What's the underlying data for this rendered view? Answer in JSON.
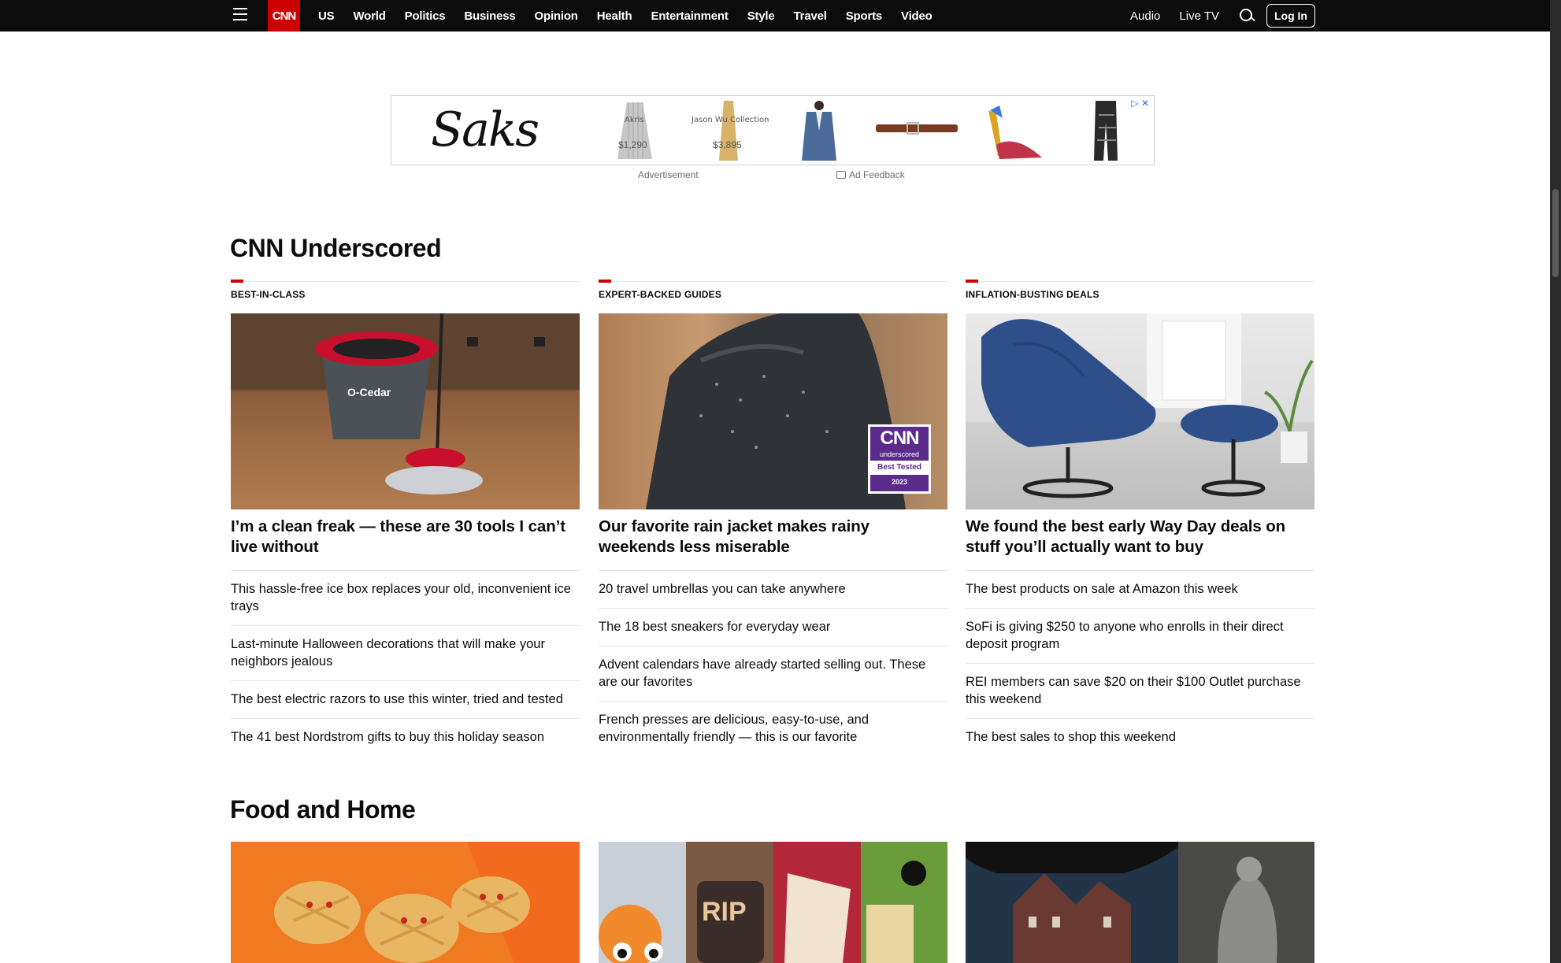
{
  "nav": {
    "logo": "CNN",
    "menu": [
      "US",
      "World",
      "Politics",
      "Business",
      "Opinion",
      "Health",
      "Entertainment",
      "Style",
      "Travel",
      "Sports",
      "Video"
    ],
    "audio": "Audio",
    "live_tv": "Live TV",
    "login": "Log In"
  },
  "ad": {
    "brand": "Saks",
    "products": [
      {
        "name": "Akris",
        "price": "$1,290"
      },
      {
        "name": "Jason Wu Collection",
        "price": "$3,895"
      }
    ],
    "label": "Advertisement",
    "feedback": "Ad Feedback"
  },
  "underscored": {
    "title": "CNN Underscored",
    "columns": [
      {
        "kicker": "BEST-IN-CLASS",
        "image_text": "O-Cedar",
        "headline": "I’m a clean freak — these are 30 tools I can’t live without",
        "links": [
          "This hassle-free ice box replaces your old, inconvenient ice trays",
          "Last-minute Halloween decorations that will make your neighbors jealous",
          "The best electric razors to use this winter, tried and tested",
          "The 41 best Nordstrom gifts to buy this holiday season"
        ]
      },
      {
        "kicker": "EXPERT-BACKED GUIDES",
        "badge": {
          "logo": "CNN",
          "sub": "underscored",
          "tag": "Best Tested",
          "year": "2023"
        },
        "headline": "Our favorite rain jacket makes rainy weekends less miserable",
        "links": [
          "20 travel umbrellas you can take anywhere",
          "The 18 best sneakers for everyday wear",
          "Advent calendars have already started selling out. These are our favorites",
          "French presses are delicious, easy-to-use, and environmentally friendly — this is our favorite"
        ]
      },
      {
        "kicker": "INFLATION-BUSTING DEALS",
        "headline": "We found the best early Way Day deals on stuff you’ll actually want to buy",
        "links": [
          "The best products on sale at Amazon this week",
          "SoFi is giving $250 to anyone who enrolls in their direct deposit program",
          "REI members can save $20 on their $100 Outlet purchase this weekend",
          "The best sales to shop this weekend"
        ]
      }
    ]
  },
  "food": {
    "title": "Food and Home",
    "rip_text": "RIP"
  }
}
